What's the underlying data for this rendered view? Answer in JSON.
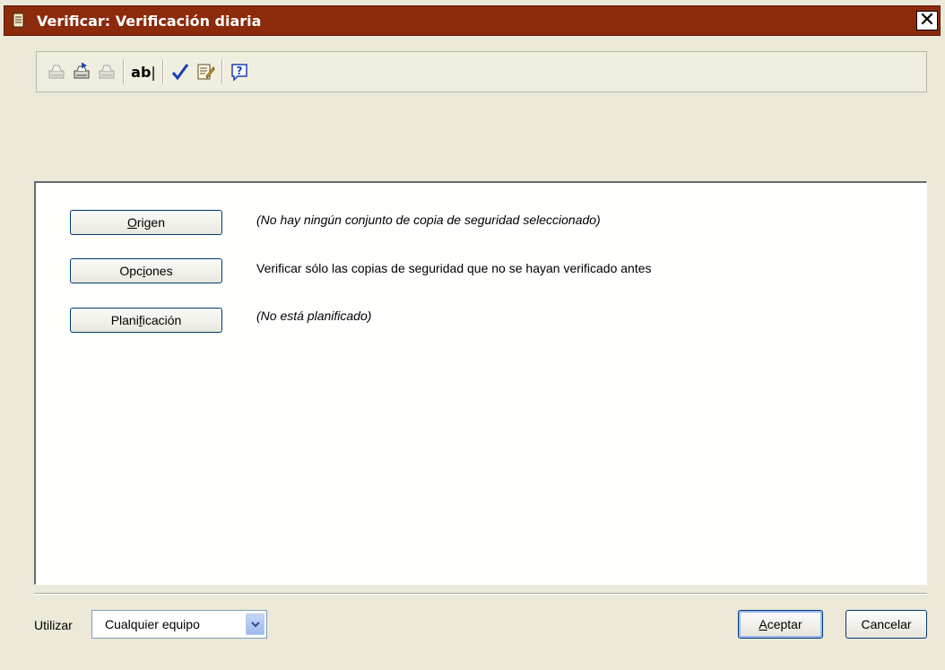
{
  "window": {
    "title": "Verificar: Verificación diaria",
    "close_label": "✕"
  },
  "toolbar": {
    "buttons": [
      {
        "icon": "print-disabled-icon"
      },
      {
        "icon": "export-icon"
      },
      {
        "icon": "print-gray-icon"
      },
      {
        "icon": "rename-icon",
        "label": "ab"
      },
      {
        "icon": "checkmark-icon"
      },
      {
        "icon": "properties-icon"
      },
      {
        "icon": "help-icon",
        "label": "?"
      }
    ]
  },
  "main": {
    "rows": [
      {
        "button_pre": "",
        "button_u": "O",
        "button_post": "rigen",
        "description": "(No hay ningún conjunto de copia de seguridad seleccionado)"
      },
      {
        "button_pre": "Opc",
        "button_u": "i",
        "button_post": "ones",
        "description": "Verificar sólo las copias de seguridad que no se hayan verificado antes"
      },
      {
        "button_pre": "Plani",
        "button_u": "f",
        "button_post": "icación",
        "description": "(No está planificado)"
      }
    ]
  },
  "footer": {
    "use_label": "Utilizar",
    "select_value": "Cualquier equipo",
    "accept_u": "A",
    "accept_rest": "ceptar",
    "cancel_label": "Cancelar"
  },
  "colors": {
    "titlebar": "#8c2a0c",
    "dialog_bg": "#ece9d8",
    "accent": "#003c74"
  }
}
